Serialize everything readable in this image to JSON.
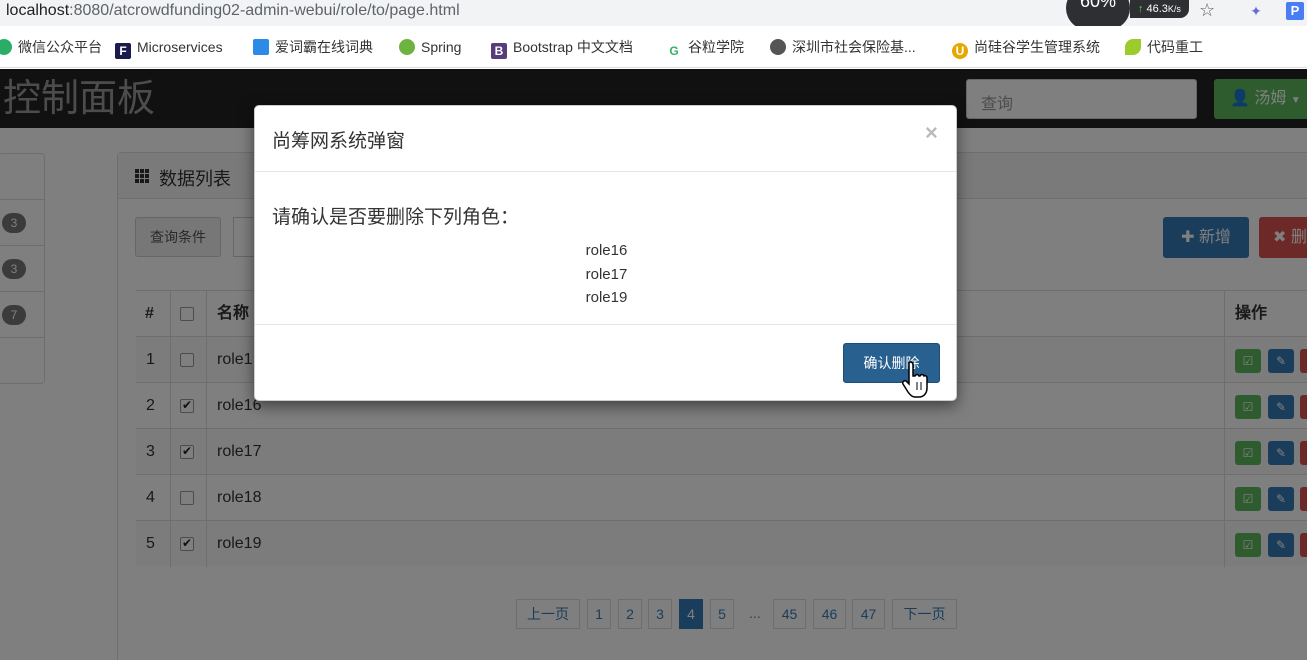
{
  "browser": {
    "url_host": "localhost",
    "url_path": ":8080/atcrowdfunding02-admin-webui/role/to/page.html",
    "net_widget": "60%",
    "net_speed": "46.3",
    "net_unit": "K/s",
    "bookmarks": [
      {
        "label": "微信公众平台",
        "icon": "wechat-icon",
        "color": "#2aae67"
      },
      {
        "label": "Microservices",
        "icon": "f-icon",
        "color": "#1a1a4e"
      },
      {
        "label": "爱词霸在线词典",
        "icon": "iciba-icon",
        "color": "#2b8be6"
      },
      {
        "label": "Spring",
        "icon": "spring-leaf-icon",
        "color": "#6db33f"
      },
      {
        "label": "Bootstrap 中文文档",
        "icon": "bootstrap-icon",
        "color": "#563d7c"
      },
      {
        "label": "谷粒学院",
        "icon": "g-icon",
        "color": "#31b36b"
      },
      {
        "label": "深圳市社会保险基...",
        "icon": "globe-icon",
        "color": "#555555"
      },
      {
        "label": "尚硅谷学生管理系统",
        "icon": "u-icon",
        "color": "#e6a700"
      },
      {
        "label": "代码重工",
        "icon": "leaf-icon",
        "color": "#9ccc2c"
      }
    ]
  },
  "navbar": {
    "brand": "控制面板",
    "search_placeholder": "查询",
    "user_label": "汤姆"
  },
  "sidebar": {
    "badges": [
      "3",
      "3",
      "7"
    ]
  },
  "panel": {
    "title": "数据列表",
    "cond_label": "查询条件",
    "add_label": "新增",
    "delete_label": "删"
  },
  "table": {
    "headers": {
      "index": "#",
      "name": "名称",
      "actions": "操作"
    },
    "rows": [
      {
        "index": "1",
        "name": "role1",
        "checked": false
      },
      {
        "index": "2",
        "name": "role16",
        "checked": true
      },
      {
        "index": "3",
        "name": "role17",
        "checked": true
      },
      {
        "index": "4",
        "name": "role18",
        "checked": false
      },
      {
        "index": "5",
        "name": "role19",
        "checked": true
      }
    ]
  },
  "pagination": {
    "prev": "上一页",
    "next": "下一页",
    "pages_before": [
      "1",
      "2",
      "3"
    ],
    "current": "4",
    "page_after": "5",
    "ellipsis": "...",
    "pages_tail": [
      "45",
      "46",
      "47"
    ]
  },
  "modal": {
    "title": "尚筹网系统弹窗",
    "close": "×",
    "question": "请确认是否要删除下列角色：",
    "roles": [
      "role16",
      "role17",
      "role19"
    ],
    "confirm_label": "确认删除"
  },
  "colors": {
    "primary": "#337ab7",
    "success": "#5cb85c",
    "danger": "#d9534f",
    "navbar": "#222222"
  }
}
